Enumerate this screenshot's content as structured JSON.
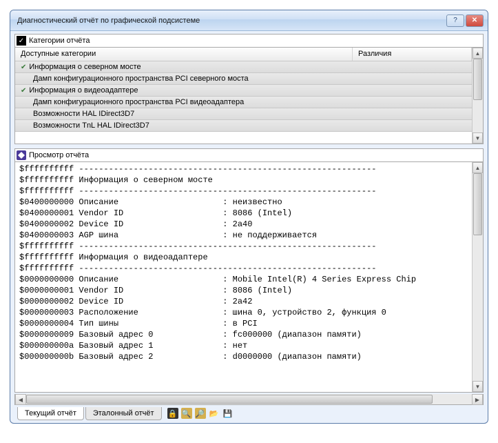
{
  "window": {
    "title": "Диагностический отчёт по графической подсистеме"
  },
  "categories_header": "Категории отчёта",
  "categories": {
    "col_a": "Доступные категории",
    "col_b": "Различия",
    "rows": [
      {
        "label": "Информация о северном мосте",
        "checked": true,
        "indent": false
      },
      {
        "label": "Дамп конфигурационного пространства PCI северного моста",
        "checked": false,
        "indent": true
      },
      {
        "label": "Информация о видеоадаптере",
        "checked": true,
        "indent": false
      },
      {
        "label": "Дамп конфигурационного пространства PCI видеоадаптера",
        "checked": false,
        "indent": true
      },
      {
        "label": "Возможности HAL IDirect3D7",
        "checked": false,
        "indent": true
      },
      {
        "label": "Возможности TnL HAL IDirect3D7",
        "checked": false,
        "indent": true
      }
    ]
  },
  "viewer_header": "Просмотр отчёта",
  "report_lines": [
    "$ffffffffff ------------------------------------------------------------",
    "$ffffffffff Информация о северном мосте",
    "$ffffffffff ------------------------------------------------------------",
    "$0400000000 Описание                     : неизвестно",
    "$0400000001 Vendor ID                    : 8086 (Intel)",
    "$0400000002 Device ID                    : 2a40",
    "$0400000003 AGP шина                     : не поддерживается",
    "$ffffffffff ------------------------------------------------------------",
    "$ffffffffff Информация о видеоадаптере",
    "$ffffffffff ------------------------------------------------------------",
    "$0000000000 Описание                     : Mobile Intel(R) 4 Series Express Chip",
    "$0000000001 Vendor ID                    : 8086 (Intel)",
    "$0000000002 Device ID                    : 2a42",
    "$0000000003 Расположение                 : шина 0, устройство 2, функция 0",
    "$0000000004 Тип шины                     : в PCI",
    "$0000000009 Базовый адрес 0              : fc000000 (диапазон памяти)",
    "$000000000a Базовый адрес 1              : нет",
    "$000000000b Базовый адрес 2              : d0000000 (диапазон памяти)"
  ],
  "tabs": {
    "current": "Текущий отчёт",
    "reference": "Эталонный отчёт"
  },
  "toolbar_icons": [
    "lock-icon",
    "find-icon",
    "compare-icon",
    "open-icon",
    "save-icon"
  ]
}
